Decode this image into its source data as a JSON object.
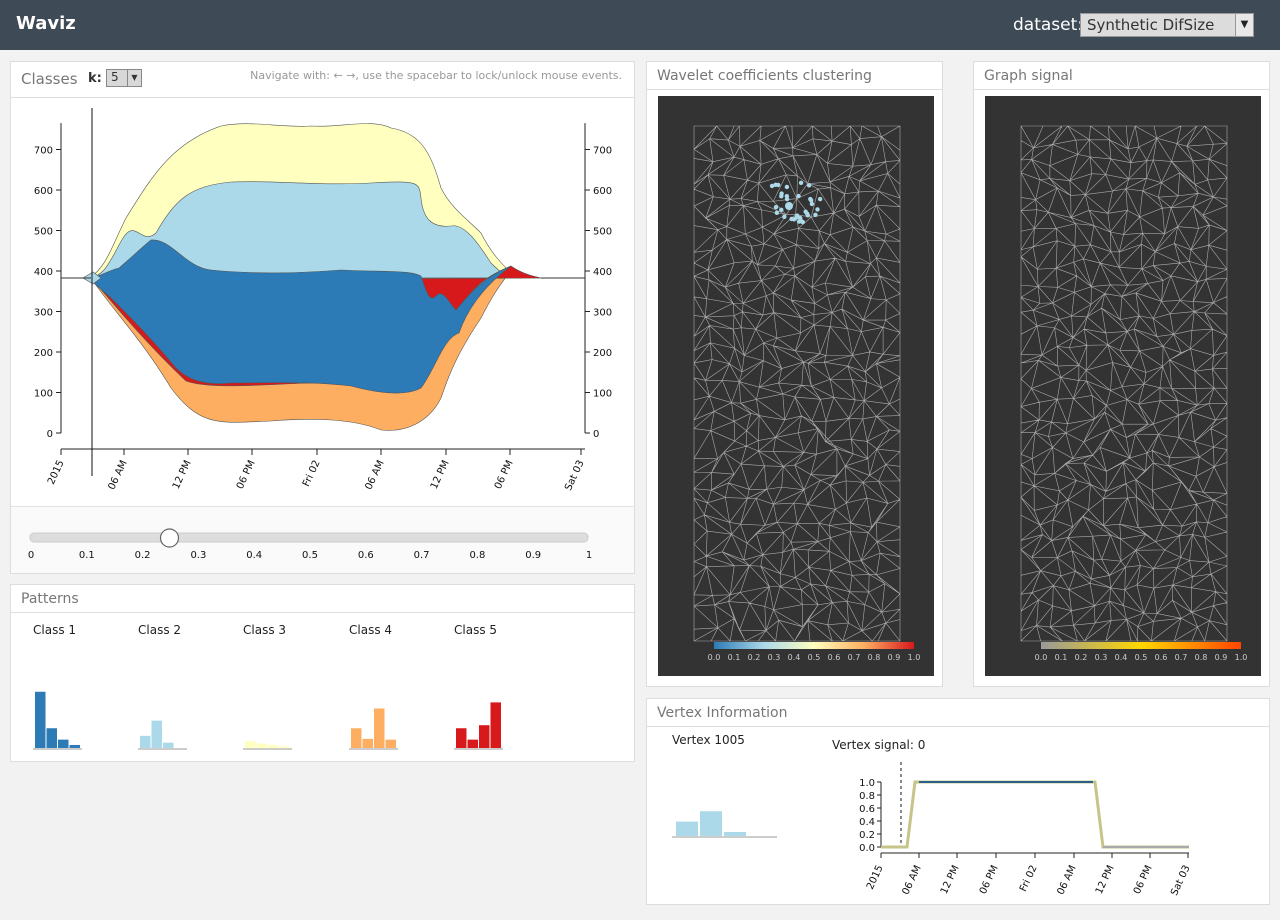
{
  "app": {
    "title": "Waviz"
  },
  "dataset": {
    "label": "dataset:",
    "value": "Synthetic DifSize"
  },
  "classes": {
    "title": "Classes",
    "k_label": "k:",
    "k_value": "5",
    "nav_hint": "Navigate with: ← →, use the spacebar to lock/unlock mouse events.",
    "y_ticks": [
      "0",
      "100",
      "200",
      "300",
      "400",
      "500",
      "600",
      "700"
    ],
    "x_ticks": [
      "2015",
      "06 AM",
      "12 PM",
      "06 PM",
      "Fri 02",
      "06 AM",
      "12 PM",
      "06 PM",
      "Sat 03"
    ],
    "colors": [
      "#2c7bb6",
      "#abd9e9",
      "#ffffbf",
      "#fdae61",
      "#d7191c"
    ]
  },
  "slider": {
    "value": 0.25,
    "ticks": [
      "0",
      "0.1",
      "0.2",
      "0.3",
      "0.4",
      "0.5",
      "0.6",
      "0.7",
      "0.8",
      "0.9",
      "1"
    ]
  },
  "patterns": {
    "title": "Patterns",
    "classes": [
      {
        "label": "Class 1",
        "color": "#2c7bb6",
        "values": [
          0.74,
          0.26,
          0.11,
          0.04
        ]
      },
      {
        "label": "Class 2",
        "color": "#abd9e9",
        "values": [
          0.16,
          0.36,
          0.07,
          0.0
        ]
      },
      {
        "label": "Class 3",
        "color": "#ffffbf",
        "values": [
          0.09,
          0.06,
          0.04,
          0.02
        ]
      },
      {
        "label": "Class 4",
        "color": "#fdae61",
        "values": [
          0.26,
          0.12,
          0.52,
          0.11
        ]
      },
      {
        "label": "Class 5",
        "color": "#d7191c",
        "values": [
          0.26,
          0.11,
          0.3,
          0.6
        ]
      }
    ]
  },
  "wavelet": {
    "title": "Wavelet coefficients clustering",
    "colorbar_ticks": [
      "0.0",
      "0.1",
      "0.2",
      "0.3",
      "0.4",
      "0.5",
      "0.6",
      "0.7",
      "0.8",
      "0.9",
      "1.0"
    ],
    "colors": [
      "#2c7bb6",
      "#abd9e9",
      "#ffffbf",
      "#fdae61",
      "#d7191c"
    ]
  },
  "graph": {
    "title": "Graph signal",
    "colorbar_ticks": [
      "0.0",
      "0.1",
      "0.2",
      "0.3",
      "0.4",
      "0.5",
      "0.6",
      "0.7",
      "0.8",
      "0.9",
      "1.0"
    ],
    "colors": [
      "#999999",
      "#ffd700",
      "#ff4500"
    ]
  },
  "vertex": {
    "title": "Vertex Information",
    "vertex_label": "Vertex 1005",
    "signal_label": "Vertex signal: 0",
    "bars": [
      0.36,
      0.62,
      0.1
    ],
    "bar_color": "#abd9e9",
    "y_ticks": [
      "0.0",
      "0.2",
      "0.4",
      "0.6",
      "0.8",
      "1.0"
    ],
    "x_ticks": [
      "2015",
      "06 AM",
      "12 PM",
      "06 PM",
      "Fri 02",
      "06 AM",
      "12 PM",
      "06 PM",
      "Sat 03"
    ]
  }
}
